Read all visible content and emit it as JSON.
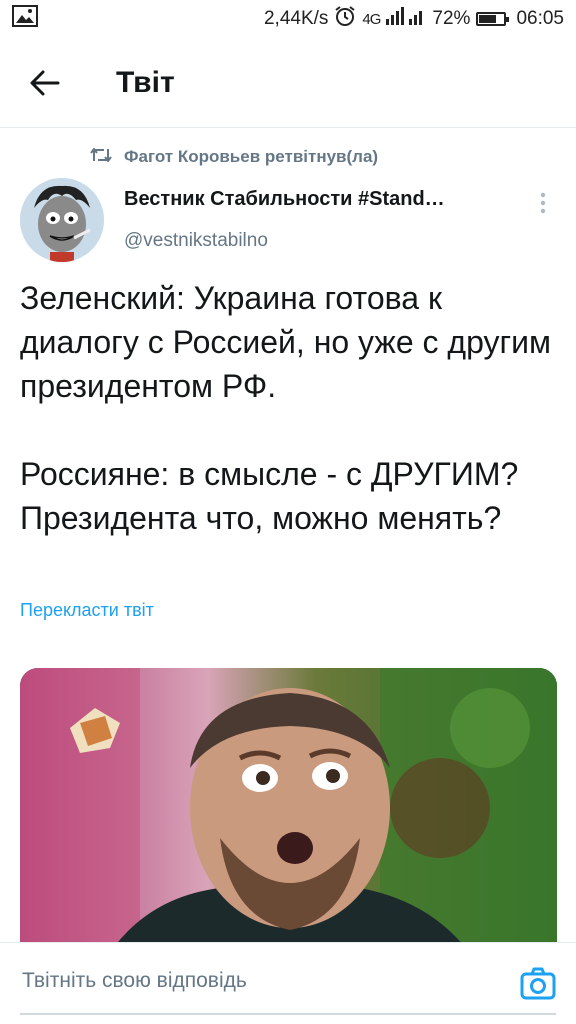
{
  "status_bar": {
    "network_speed": "2,44K/s",
    "network_type": "4G",
    "battery_percent": "72%",
    "battery_level": 0.72,
    "time": "06:05"
  },
  "header": {
    "title": "Твіт"
  },
  "retweet": {
    "text": "Фагот Коровьев ретвітнув(ла)"
  },
  "tweet": {
    "author_name": "Вестник Стабильности #Stand…",
    "author_handle": "@vestnikstabilno",
    "text": "Зеленский: Украина готова к диалогу с Россией, но уже с другим президентом РФ.\n\nРоссияне: в смысле - с ДРУГИМ? Президента что, можно менять?",
    "translate_label": "Перекласти твіт"
  },
  "reply": {
    "placeholder": "Твітніть свою відповідь"
  },
  "colors": {
    "accent": "#1da1f2",
    "secondary_text": "#657786",
    "primary_text": "#14171a"
  },
  "icons": {
    "back": "arrow-left-icon",
    "retweet": "retweet-icon",
    "more": "more-vertical-icon",
    "camera": "camera-icon",
    "gallery": "gallery-icon",
    "alarm": "alarm-icon"
  }
}
